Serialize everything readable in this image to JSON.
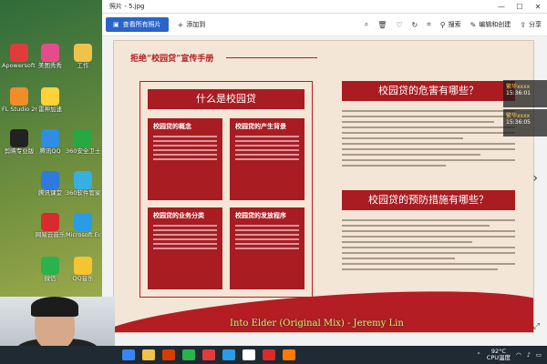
{
  "desktop": {
    "icons": [
      {
        "label": "Apowersoft 录屏王",
        "color": "#e23b3b"
      },
      {
        "label": "美图秀秀",
        "color": "#e64c8c"
      },
      {
        "label": "工作",
        "color": "#f0c24a"
      },
      {
        "label": "FL Studio 20",
        "color": "#f08c2a"
      },
      {
        "label": "雷神加速",
        "color": "#ffd23a"
      },
      {
        "label": "剪映专业版",
        "color": "#222222"
      },
      {
        "label": "腾讯QQ",
        "color": "#2f8de4"
      },
      {
        "label": "360安全卫士",
        "color": "#27a844"
      },
      {
        "label": "腾讯课堂",
        "color": "#2d7ae0"
      },
      {
        "label": "360软件管家",
        "color": "#36b0e0"
      },
      {
        "label": "网易云音乐",
        "color": "#d82b2b"
      },
      {
        "label": "Microsoft Edge",
        "color": "#2a9be6"
      },
      {
        "label": "微信",
        "color": "#2bb24c"
      },
      {
        "label": "QQ音乐",
        "color": "#f4c531"
      }
    ]
  },
  "viewer": {
    "window_title": "照片 - 5.jpg",
    "toolbar": {
      "view_all": "查看所有照片",
      "add_to": "添加到",
      "search": "搜索",
      "edit_create": "编辑和创建",
      "share": "分享"
    },
    "poster": {
      "main_title": "拒绝“校园贷”宣传手册",
      "left_heading": "什么是校园贷",
      "cards": [
        "校园贷的概念",
        "校园贷的产生背景",
        "校园贷的业务分类",
        "校园贷的发放程序"
      ],
      "right_heading_1": "校园贷的危害有哪些？",
      "right_heading_2": "校园贷的预防措施有哪些？"
    }
  },
  "notifications": [
    {
      "title": "繁华xxxx",
      "time": "15:36:01"
    },
    {
      "title": "繁华xxxx",
      "time": "15:36:05"
    }
  ],
  "overlay": {
    "song": "Into Elder (Original Mix) - Jeremy Lin"
  },
  "taskbar": {
    "temperature": "92°C",
    "cpu_label": "CPU温度"
  }
}
